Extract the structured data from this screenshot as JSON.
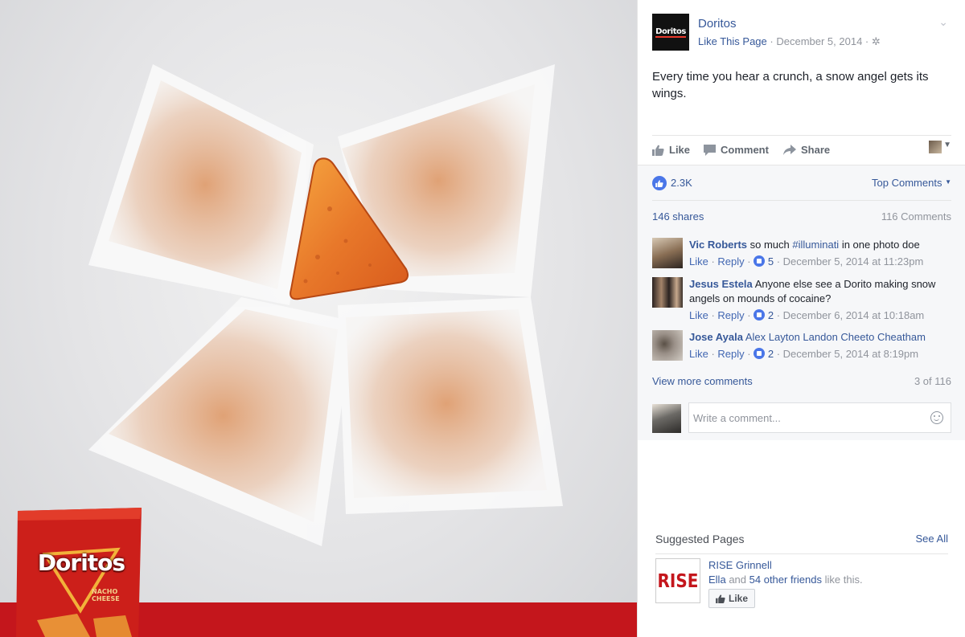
{
  "post": {
    "page_name": "Doritos",
    "avatar_logo_text": "Doritos",
    "like_page_label": "Like This Page",
    "date": "December 5, 2014",
    "text": "Every time you hear a crunch, a snow angel gets its wings."
  },
  "actions": {
    "like": "Like",
    "comment": "Comment",
    "share": "Share"
  },
  "feedback": {
    "like_count": "2.3K",
    "sort_label": "Top Comments",
    "shares": "146 shares",
    "comment_count": "116 Comments",
    "view_more": "View more comments",
    "pager": "3 of 116",
    "comment_placeholder": "Write a comment..."
  },
  "comments": [
    {
      "name": "Vic Roberts",
      "text": "so much ",
      "tag": "#illuminati",
      "text_after": " in one photo doe",
      "like": "Like",
      "reply": "Reply",
      "likes": "5",
      "date": "December 5, 2014 at 11:23pm"
    },
    {
      "name": "Jesus Estela",
      "text": "Anyone else see a Dorito making snow angels on mounds of cocaine?",
      "like": "Like",
      "reply": "Reply",
      "likes": "2",
      "date": "December 6, 2014 at 10:18am"
    },
    {
      "name": "Jose Ayala",
      "tag": "Alex Layton Landon Cheeto Cheatham",
      "like": "Like",
      "reply": "Reply",
      "likes": "2",
      "date": "December 5, 2014 at 8:19pm"
    }
  ],
  "suggested": {
    "title": "Suggested Pages",
    "see_all": "See All",
    "page_name": "RISE Grinnell",
    "logo_text": "RISE",
    "friend_name": "Ella",
    "friends_and": "and",
    "friends_count": "54 other friends",
    "friends_suffix": "like this.",
    "like_button": "Like"
  },
  "photo": {
    "bag_brand": "Doritos",
    "bag_flavor_1": "NACHO",
    "bag_flavor_2": "CHEESE"
  },
  "colors": {
    "link": "#365899",
    "accent_red": "#c4161c",
    "like_blue": "#4a76e8"
  }
}
